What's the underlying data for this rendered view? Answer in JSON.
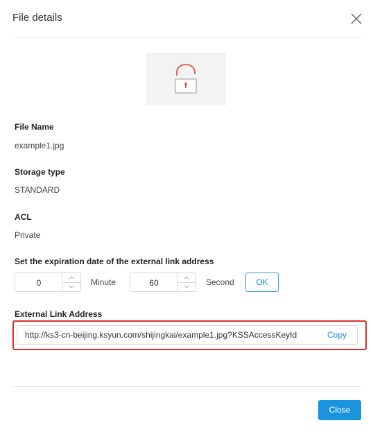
{
  "dialog": {
    "title": "File details",
    "close_icon": "close-icon"
  },
  "preview": {
    "icon": "unlock-icon",
    "accent": "#e5604e"
  },
  "file_name": {
    "label": "File Name",
    "value": "example1.jpg"
  },
  "storage_type": {
    "label": "Storage type",
    "value": "STANDARD"
  },
  "acl": {
    "label": "ACL",
    "value": "Private"
  },
  "expiration": {
    "label": "Set the expiration date of the external link address",
    "minutes_value": "0",
    "minutes_unit": "Minute",
    "seconds_value": "60",
    "seconds_unit": "Second",
    "ok_label": "OK"
  },
  "external_link": {
    "label": "External Link Address",
    "url": "http://ks3-cn-beijing.ksyun.com/shijingkai/example1.jpg?KSSAccessKeyId",
    "copy_label": "Copy",
    "highlight_color": "#e02b2b"
  },
  "footer": {
    "close_label": "Close",
    "button_color": "#1a95dd"
  }
}
